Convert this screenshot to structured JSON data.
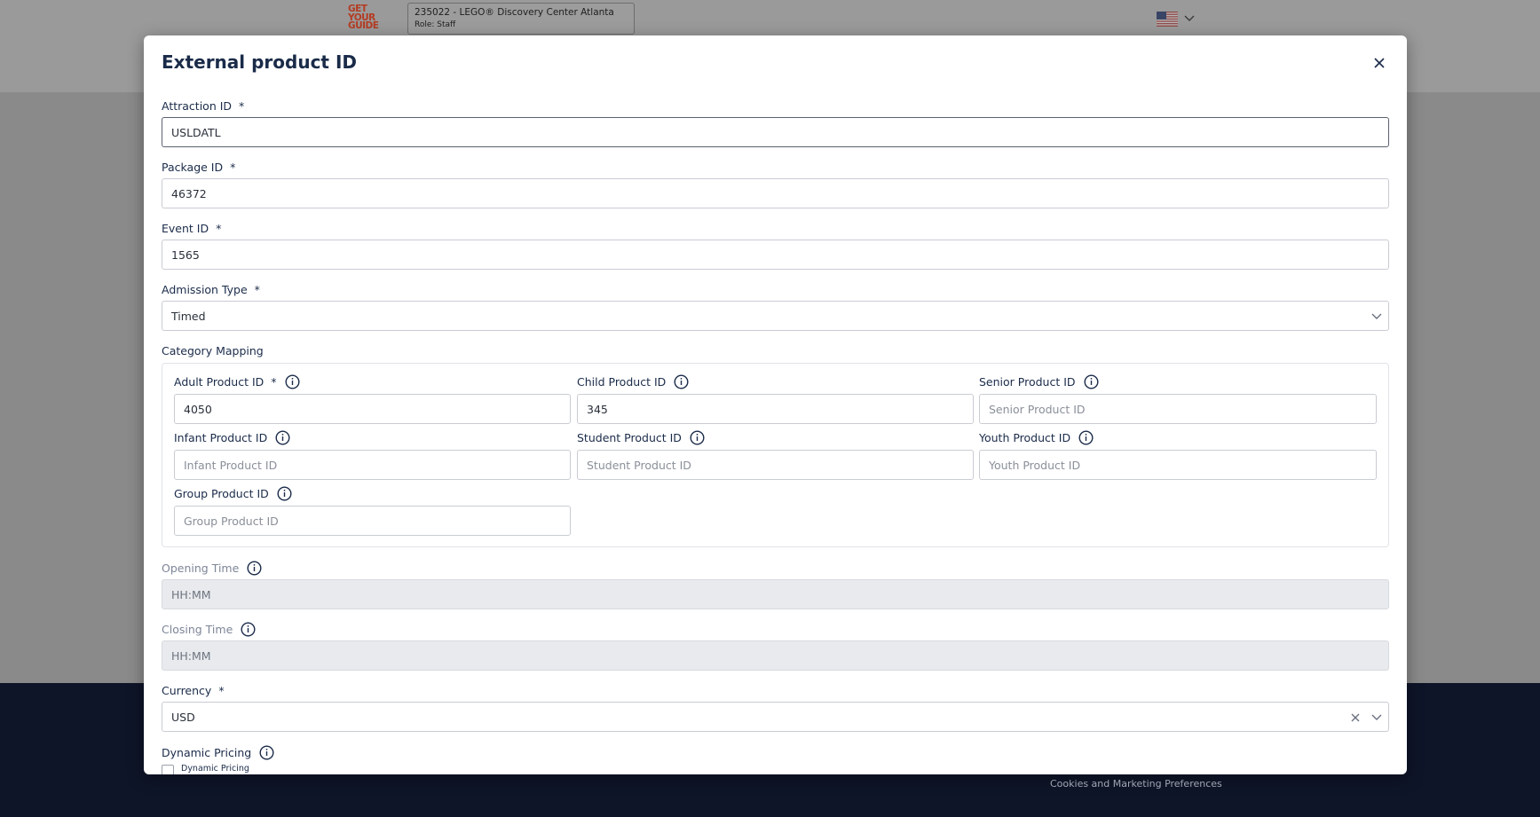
{
  "header": {
    "logo_lines": [
      "GET",
      "YOUR",
      "GUIDE"
    ],
    "account_title": "235022 - LEGO® Discovery Center Atlanta",
    "account_role": "Role: Staff"
  },
  "footer": {
    "cookies_link": "Cookies and Marketing Preferences"
  },
  "modal": {
    "title": "External product ID",
    "attraction_id": {
      "label": "Attraction ID",
      "required": "*",
      "value": "USLDATL"
    },
    "package_id": {
      "label": "Package ID",
      "required": "*",
      "value": "46372"
    },
    "event_id": {
      "label": "Event ID",
      "required": "*",
      "value": "1565"
    },
    "admission_type": {
      "label": "Admission Type",
      "required": "*",
      "value": "Timed"
    },
    "category_mapping": {
      "label": "Category Mapping",
      "adult": {
        "label": "Adult Product ID",
        "required": "*",
        "value": "4050",
        "placeholder": "Adult Product ID"
      },
      "child": {
        "label": "Child Product ID",
        "value": "345",
        "placeholder": "Child Product ID"
      },
      "senior": {
        "label": "Senior Product ID",
        "value": "",
        "placeholder": "Senior Product ID"
      },
      "infant": {
        "label": "Infant Product ID",
        "value": "",
        "placeholder": "Infant Product ID"
      },
      "student": {
        "label": "Student Product ID",
        "value": "",
        "placeholder": "Student Product ID"
      },
      "youth": {
        "label": "Youth Product ID",
        "value": "",
        "placeholder": "Youth Product ID"
      },
      "group": {
        "label": "Group Product ID",
        "value": "",
        "placeholder": "Group Product ID"
      }
    },
    "opening_time": {
      "label": "Opening Time",
      "placeholder": "HH:MM"
    },
    "closing_time": {
      "label": "Closing Time",
      "placeholder": "HH:MM"
    },
    "currency": {
      "label": "Currency",
      "required": "*",
      "value": "USD"
    },
    "dynamic_pricing": {
      "label": "Dynamic Pricing",
      "checkbox_label": "Dynamic Pricing"
    }
  },
  "colors": {
    "text_primary": "#1a2b49",
    "logo": "#b33c22",
    "footer": "#0e1528",
    "disabled_field": "#e8eaed"
  },
  "icons": [
    "us-flag-icon",
    "chevron-down-icon",
    "close-icon",
    "info-icon",
    "clear-icon"
  ]
}
